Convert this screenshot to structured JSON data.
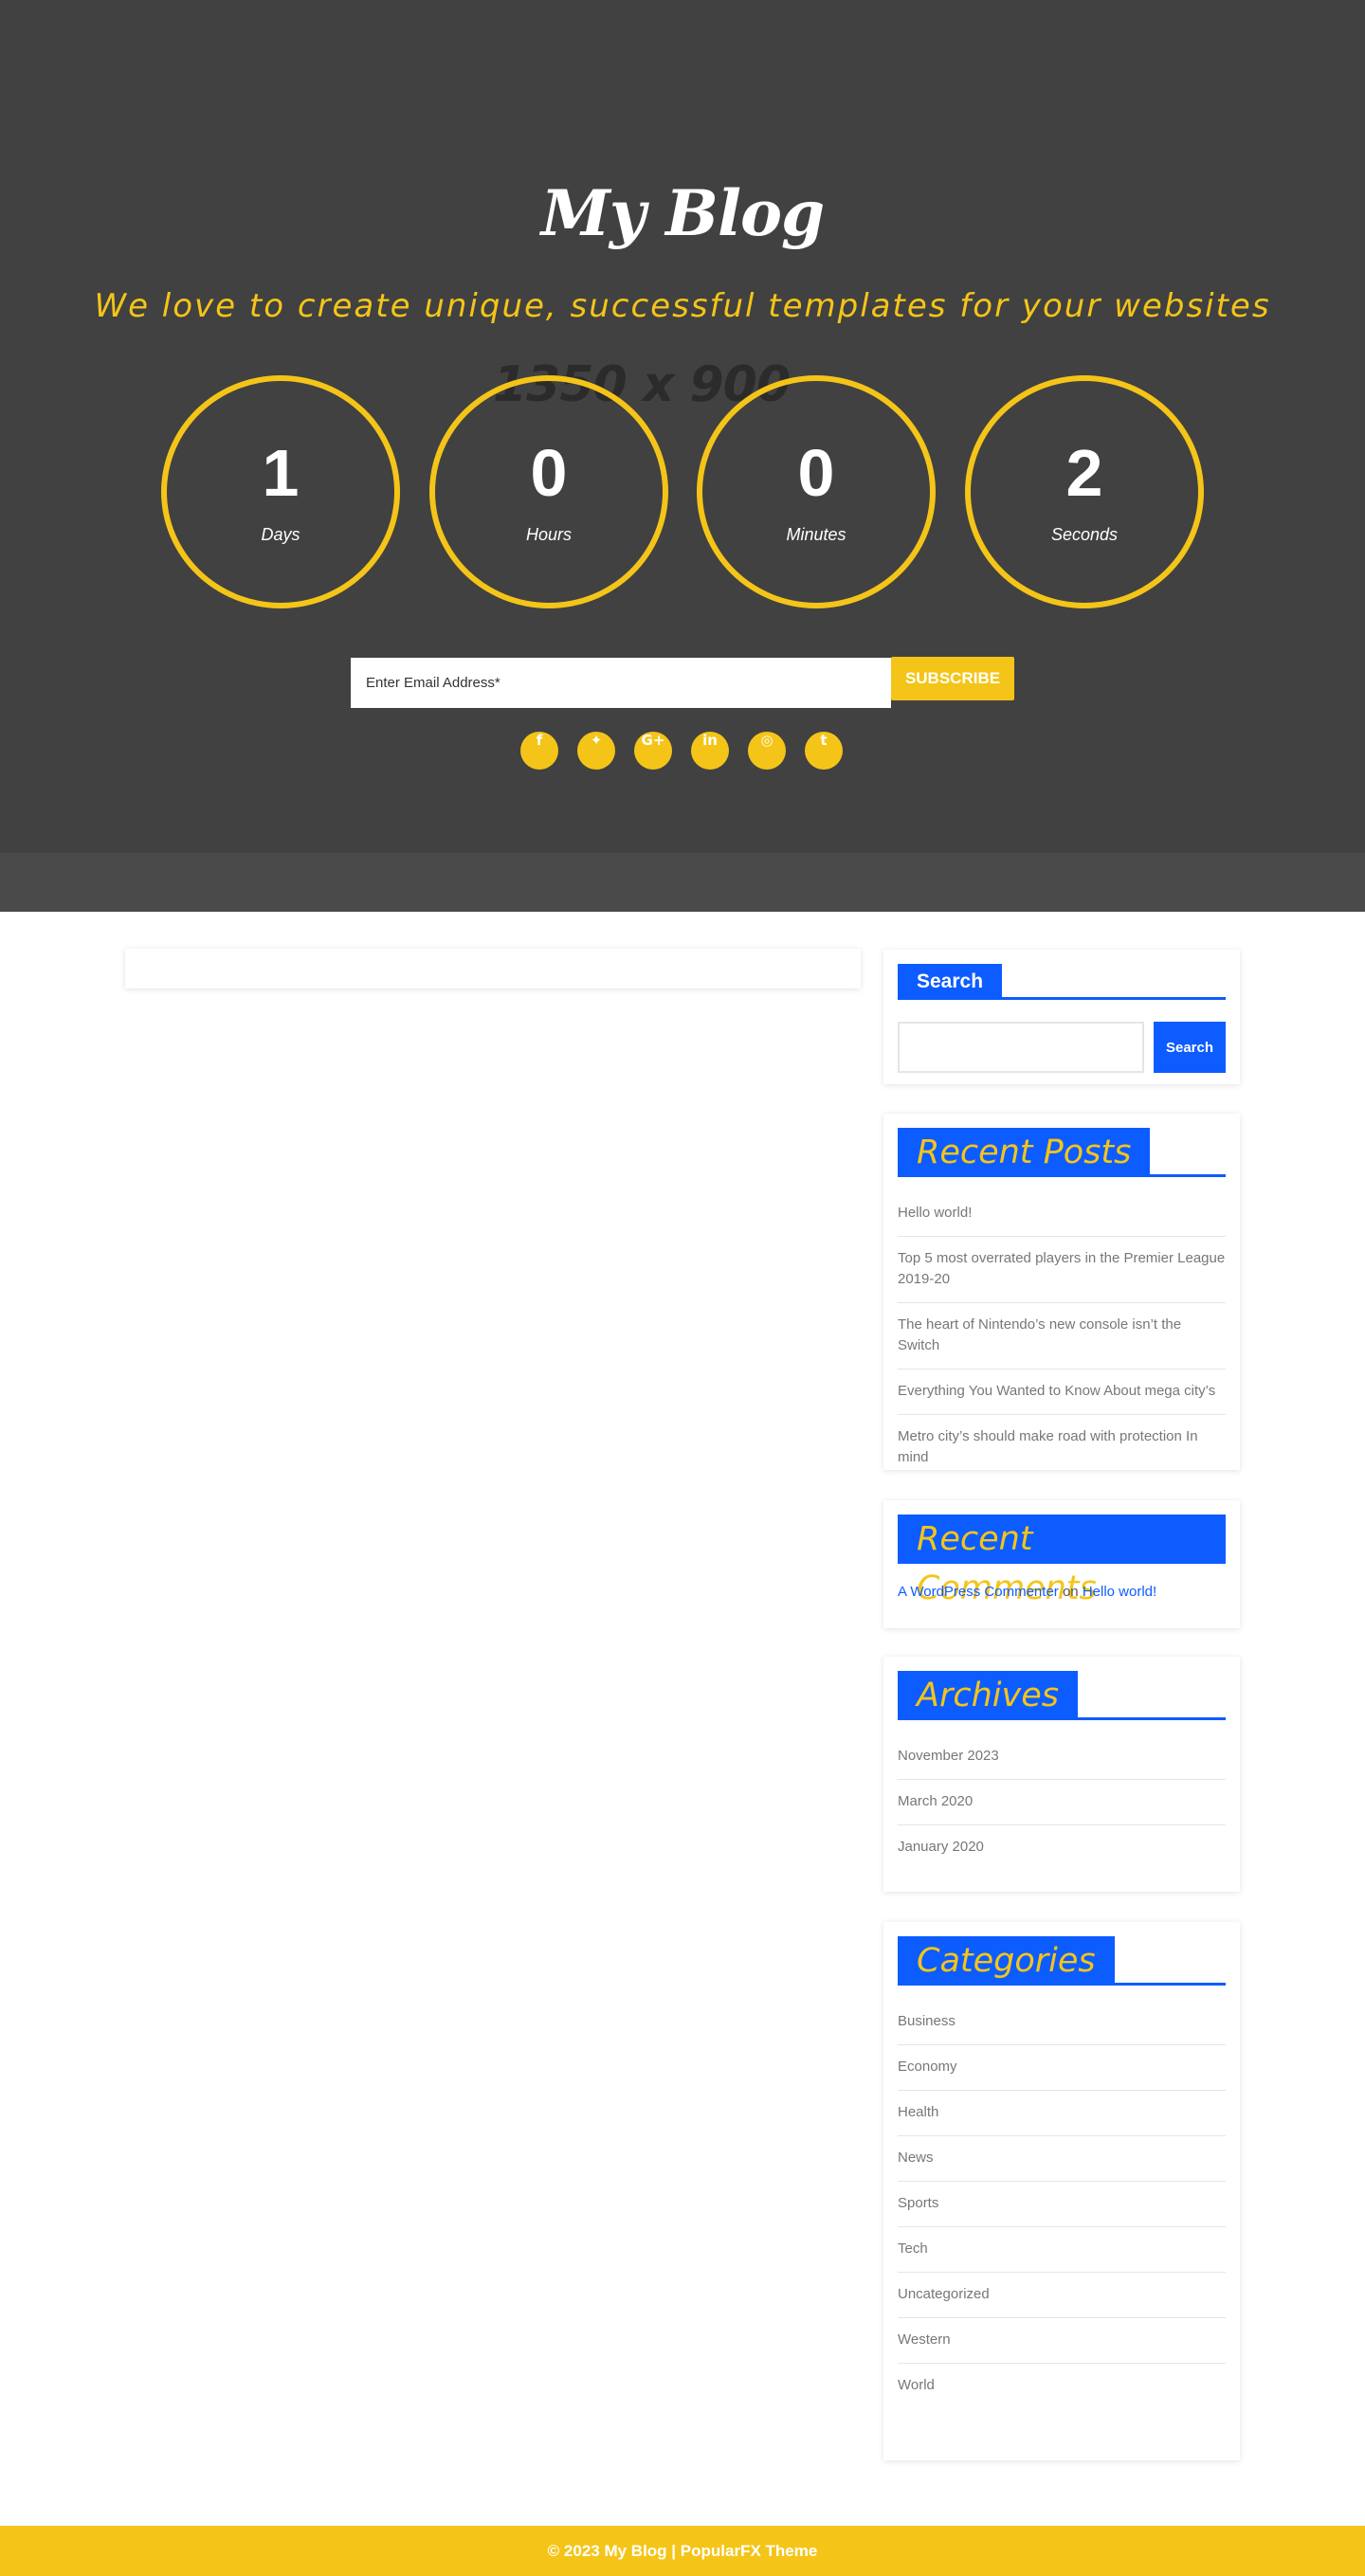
{
  "hero": {
    "placeholder": "1350 x 900",
    "title": "My Blog",
    "tagline": "We love to create unique, successful templates for your websites",
    "countdown": [
      {
        "value": "1",
        "label": "Days"
      },
      {
        "value": "0",
        "label": "Hours"
      },
      {
        "value": "0",
        "label": "Minutes"
      },
      {
        "value": "2",
        "label": "Seconds"
      }
    ],
    "email_placeholder": "Enter Email Address*",
    "subscribe_label": "SUBSCRIBE",
    "social": [
      {
        "icon": "facebook-icon",
        "glyph": "f"
      },
      {
        "icon": "twitter-icon",
        "glyph": "✦"
      },
      {
        "icon": "google-plus-icon",
        "glyph": "G+"
      },
      {
        "icon": "linkedin-icon",
        "glyph": "in"
      },
      {
        "icon": "instagram-icon",
        "glyph": "◎"
      },
      {
        "icon": "tumblr-icon",
        "glyph": "t"
      }
    ]
  },
  "sidebar": {
    "search": {
      "title": "Search",
      "button": "Search"
    },
    "recent_posts": {
      "title": "Recent Posts",
      "items": [
        "Hello world!",
        "Top 5 most overrated players in the Premier League 2019-20",
        "The heart of Nintendo’s new console isn’t the Switch",
        "Everything You Wanted to Know About mega city’s",
        "Metro city’s should make road with protection In mind"
      ]
    },
    "recent_comments": {
      "title": "Recent Comments",
      "author": "A WordPress Commenter",
      "on": "on",
      "post": "Hello world!"
    },
    "archives": {
      "title": "Archives",
      "items": [
        "November 2023",
        "March 2020",
        "January 2020"
      ]
    },
    "categories": {
      "title": "Categories",
      "items": [
        "Business",
        "Economy",
        "Health",
        "News",
        "Sports",
        "Tech",
        "Uncategorized",
        "Western",
        "World"
      ]
    }
  },
  "footer": {
    "text": "© 2023 My Blog | PopularFX Theme"
  },
  "colors": {
    "accent": "#f4c518",
    "brand": "#0d5cff",
    "hero_bg": "#414141"
  }
}
